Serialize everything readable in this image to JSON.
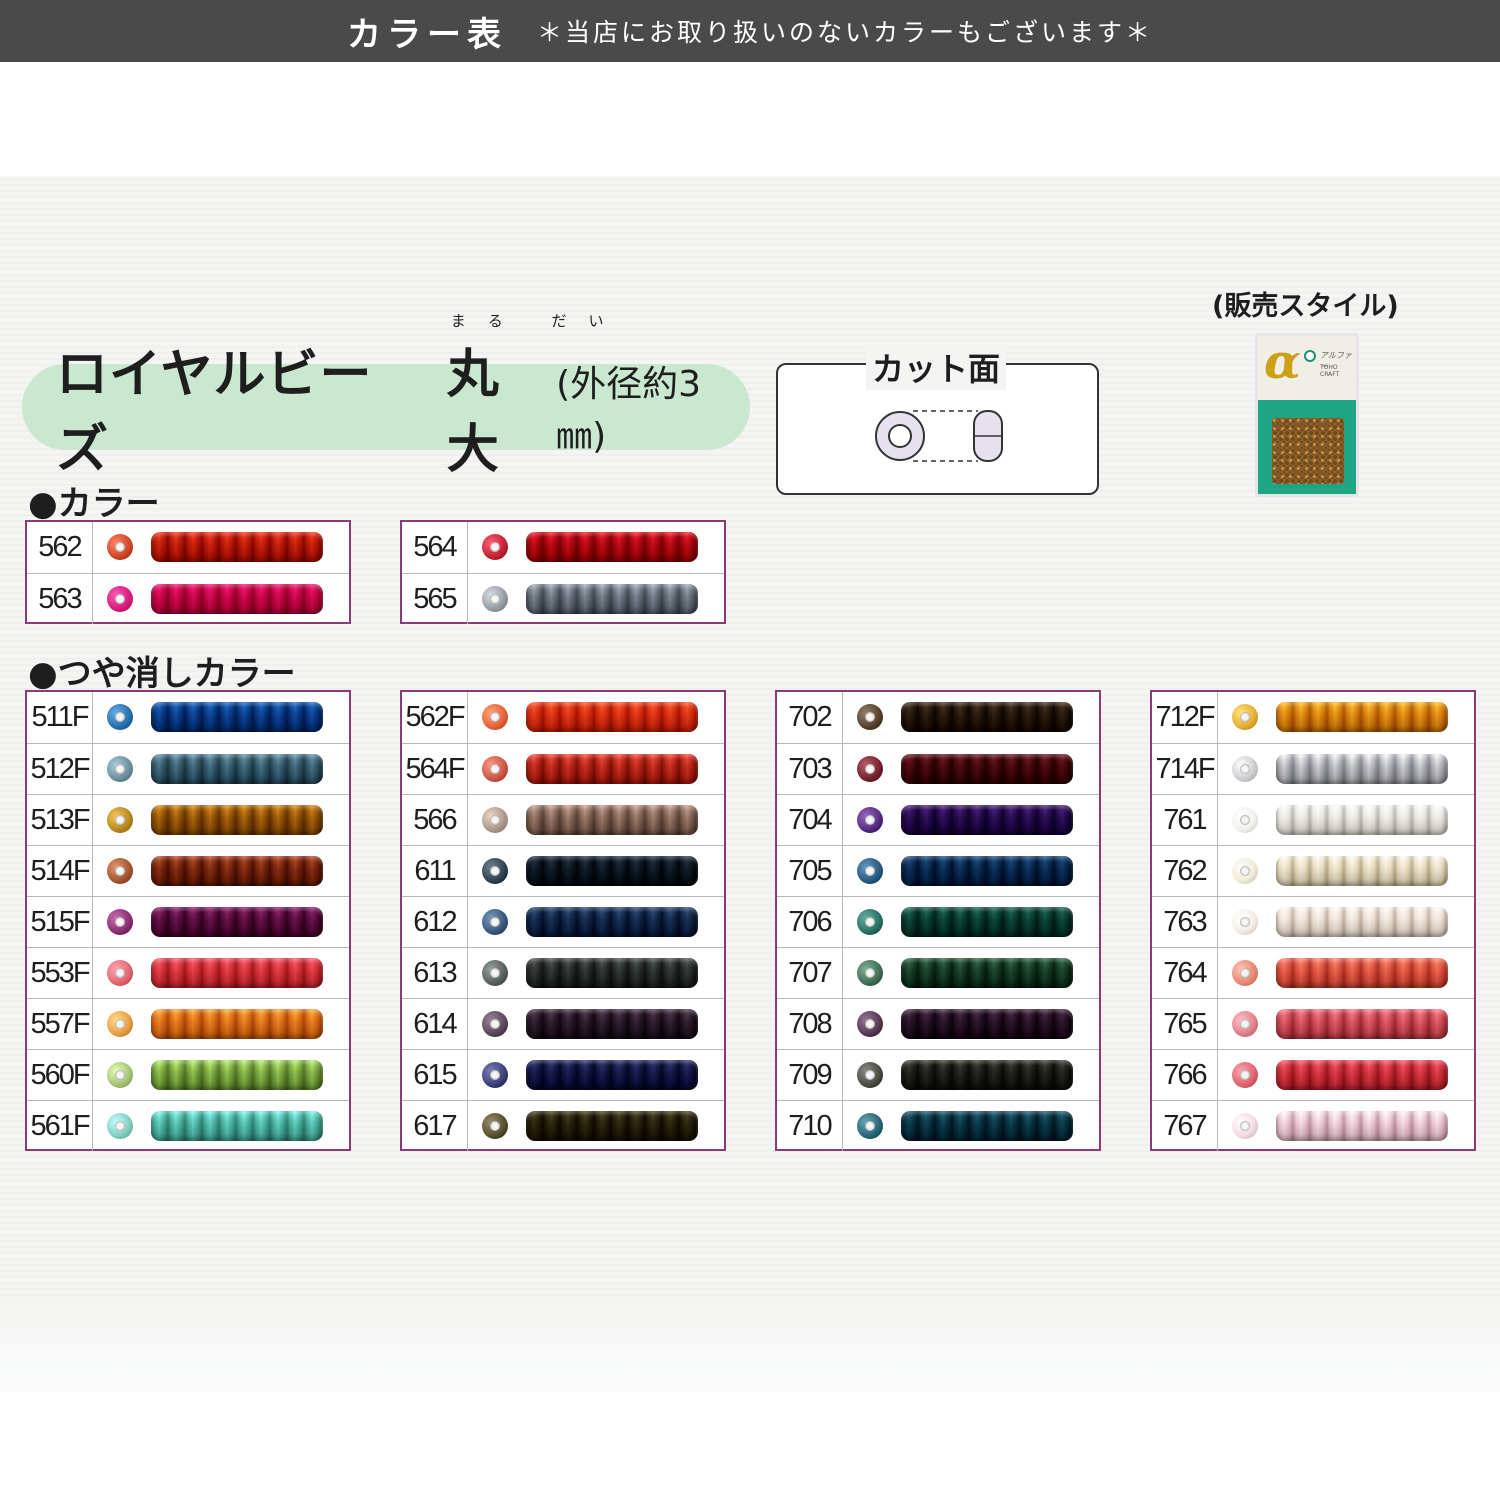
{
  "header": {
    "title": "カラー表",
    "note": "＊当店にお取り扱いのないカラーもございます＊"
  },
  "product": {
    "name": "ロイヤルビーズ",
    "kanji": "丸大",
    "ruby": "まる だい",
    "size": "(外径約3㎜)"
  },
  "cut_face": {
    "label": "カット面"
  },
  "sale_style": {
    "label": "(販売スタイル)",
    "package_brand": "アルファー",
    "package_maker": "TOHO CRAFT"
  },
  "sections": {
    "color": "●カラー",
    "matte": "●つや消しカラー"
  },
  "tables": [
    {
      "rows": [
        {
          "code": "562",
          "color": "#d24a2a"
        },
        {
          "code": "563",
          "color": "#d81f7e"
        }
      ]
    },
    {
      "rows": [
        {
          "code": "564",
          "color": "#c8243a"
        },
        {
          "code": "565",
          "color": "#9aa0a8"
        }
      ]
    },
    {
      "rows": [
        {
          "code": "511F",
          "color": "#2a73b0"
        },
        {
          "code": "512F",
          "color": "#6f92a0"
        },
        {
          "code": "513F",
          "color": "#b98b22"
        },
        {
          "code": "514F",
          "color": "#a55a34"
        },
        {
          "code": "515F",
          "color": "#8e3276"
        },
        {
          "code": "553F",
          "color": "#e46a74"
        },
        {
          "code": "557F",
          "color": "#eaa04a"
        },
        {
          "code": "560F",
          "color": "#a8c67a"
        },
        {
          "code": "561F",
          "color": "#86cfc4"
        }
      ]
    },
    {
      "rows": [
        {
          "code": "562F",
          "color": "#e6663e"
        },
        {
          "code": "564F",
          "color": "#cf5a48"
        },
        {
          "code": "566",
          "color": "#b09a8e"
        },
        {
          "code": "611",
          "color": "#334554"
        },
        {
          "code": "612",
          "color": "#3e5c80"
        },
        {
          "code": "613",
          "color": "#5d6460"
        },
        {
          "code": "614",
          "color": "#5e4a5e"
        },
        {
          "code": "615",
          "color": "#40447a"
        },
        {
          "code": "617",
          "color": "#5a5230"
        }
      ]
    },
    {
      "rows": [
        {
          "code": "702",
          "color": "#5a4530"
        },
        {
          "code": "703",
          "color": "#7a2432"
        },
        {
          "code": "704",
          "color": "#5a2e82"
        },
        {
          "code": "705",
          "color": "#2a5e86"
        },
        {
          "code": "706",
          "color": "#2a7468"
        },
        {
          "code": "707",
          "color": "#44725a"
        },
        {
          "code": "708",
          "color": "#5a3c58"
        },
        {
          "code": "709",
          "color": "#4e5048"
        },
        {
          "code": "710",
          "color": "#2a6a7a"
        }
      ]
    },
    {
      "rows": [
        {
          "code": "712F",
          "color": "#e8ae3a"
        },
        {
          "code": "714F",
          "color": "#cfd0d4"
        },
        {
          "code": "761",
          "color": "#f3f2ee"
        },
        {
          "code": "762",
          "color": "#f2ebd8"
        },
        {
          "code": "763",
          "color": "#f6eee6"
        },
        {
          "code": "764",
          "color": "#ea8a78"
        },
        {
          "code": "765",
          "color": "#e2848e"
        },
        {
          "code": "766",
          "color": "#df6874"
        },
        {
          "code": "767",
          "color": "#f4dce4"
        }
      ]
    }
  ]
}
